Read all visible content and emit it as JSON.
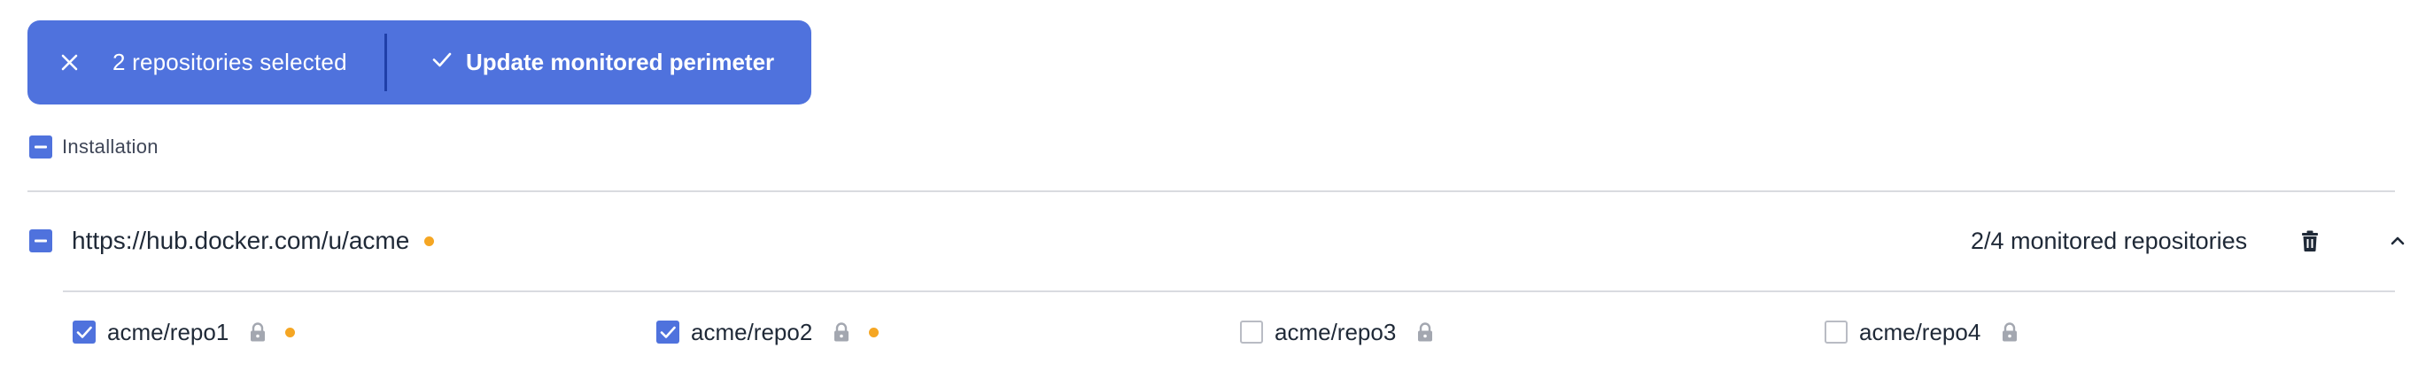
{
  "selection_bar": {
    "count_text": "2 repositories selected",
    "update_label": "Update monitored perimeter",
    "close_icon": "close-icon",
    "check_icon": "check-icon",
    "background_color": "#4f72dd"
  },
  "installation": {
    "label": "Installation",
    "checkbox_state": "indeterminate"
  },
  "source": {
    "url": "https://hub.docker.com/u/acme",
    "status_dot_color": "#f5a623",
    "monitored_text": "2/4 monitored repositories",
    "checkbox_state": "indeterminate",
    "delete_icon": "trash-icon",
    "collapse_icon": "chevron-up-icon"
  },
  "repositories": [
    {
      "name": "acme/repo1",
      "checked": true,
      "private": true,
      "status_dot": true
    },
    {
      "name": "acme/repo2",
      "checked": true,
      "private": true,
      "status_dot": true
    },
    {
      "name": "acme/repo3",
      "checked": false,
      "private": true,
      "status_dot": false
    },
    {
      "name": "acme/repo4",
      "checked": false,
      "private": true,
      "status_dot": false
    }
  ]
}
